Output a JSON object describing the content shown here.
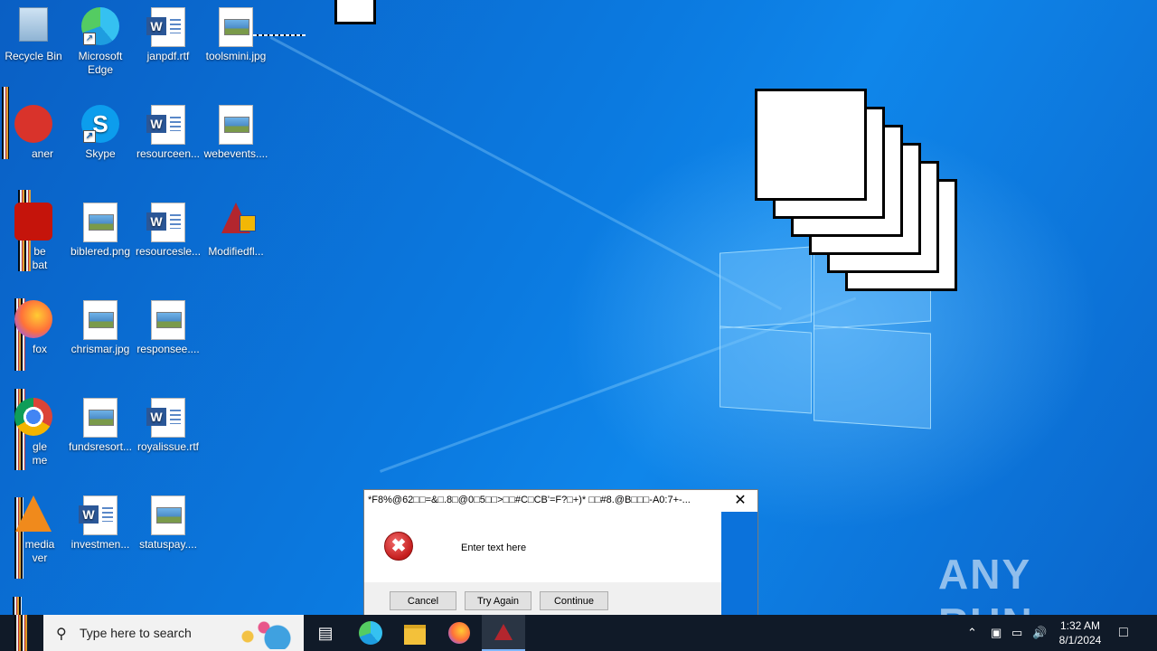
{
  "desktop_icons": [
    {
      "label": "Recycle Bin",
      "glyph": "recycle-bin-icon"
    },
    {
      "label": "Microsoft Edge",
      "glyph": "edge-icon"
    },
    {
      "label": "janpdf.rtf",
      "glyph": "word-doc-icon"
    },
    {
      "label": "toolsmini.jpg",
      "glyph": "image-file-icon"
    },
    {
      "label": "aner",
      "glyph": "ccleaner-icon"
    },
    {
      "label": "Skype",
      "glyph": "skype-icon"
    },
    {
      "label": "resourceen...",
      "glyph": "word-doc-icon"
    },
    {
      "label": "webevents....",
      "glyph": "image-file-icon"
    },
    {
      "label": "be\nbat",
      "glyph": "acrobat-icon"
    },
    {
      "label": "biblered.png",
      "glyph": "image-file-icon"
    },
    {
      "label": "resourcesle...",
      "glyph": "word-doc-icon"
    },
    {
      "label": "Modifiedfl...",
      "glyph": "flask-icon"
    },
    {
      "label": "fox",
      "glyph": "firefox-icon"
    },
    {
      "label": "chrismar.jpg",
      "glyph": "image-file-icon"
    },
    {
      "label": "responsee....",
      "glyph": "image-file-icon"
    },
    {
      "label": "gle\nme",
      "glyph": "chrome-icon"
    },
    {
      "label": "fundsresort...",
      "glyph": "image-file-icon"
    },
    {
      "label": "royalissue.rtf",
      "glyph": "word-doc-icon"
    },
    {
      "label": "media\nver",
      "glyph": "vlc-icon"
    },
    {
      "label": "investmen...",
      "glyph": "word-doc-icon"
    },
    {
      "label": "statuspay....",
      "glyph": "image-file-icon"
    }
  ],
  "dialog": {
    "title": "*F8%@62□□=&□.8□@0□5□□>□□#C□CB'=F?□+)* □□#8.@B□□□-A0:7+-...",
    "close_label": "✕",
    "error_icon": "error-icon",
    "message": "Enter text here",
    "buttons": {
      "cancel": "Cancel",
      "try_again": "Try Again",
      "continue": "Continue"
    }
  },
  "taskbar": {
    "search_placeholder": "Type here to search",
    "pinned": [
      "task-view-icon",
      "edge-icon",
      "file-explorer-icon",
      "firefox-icon",
      "flask-app-icon"
    ],
    "clock_time": "1:32 AM",
    "clock_date": "8/1/2024"
  },
  "watermark": "ANY RUN",
  "colors": {
    "wallpaper": "#0a6fd6",
    "taskbar": "#101a28",
    "dialog_bg": "#f0f0f0",
    "error_red": "#c41d1d"
  }
}
